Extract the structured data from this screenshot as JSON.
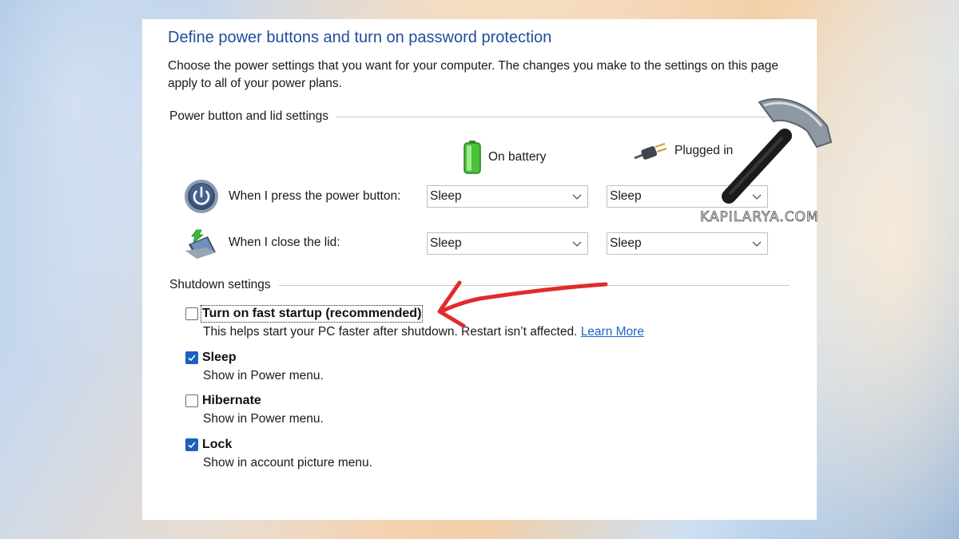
{
  "page_title": "Define power buttons and turn on password protection",
  "description": "Choose the power settings that you want for your computer. The changes you make to the settings on this page apply to all of your power plans.",
  "power_section": {
    "heading": "Power button and lid settings",
    "columns": {
      "battery": "On battery",
      "plugged": "Plugged in"
    },
    "rows": [
      {
        "label": "When I press the power button:",
        "battery_value": "Sleep",
        "plugged_value": "Sleep",
        "icon": "power-button-icon"
      },
      {
        "label": "When I close the lid:",
        "battery_value": "Sleep",
        "plugged_value": "Sleep",
        "icon": "laptop-lid-icon"
      }
    ]
  },
  "shutdown_section": {
    "heading": "Shutdown settings",
    "options": [
      {
        "label": "Turn on fast startup (recommended)",
        "checked": false,
        "description": "This helps start your PC faster after shutdown. Restart isn’t affected.",
        "link": "Learn More"
      },
      {
        "label": "Sleep",
        "checked": true,
        "description": "Show in Power menu."
      },
      {
        "label": "Hibernate",
        "checked": false,
        "description": "Show in Power menu."
      },
      {
        "label": "Lock",
        "checked": true,
        "description": "Show in account picture menu."
      }
    ]
  },
  "watermark": "KAPILARYA.COM",
  "colors": {
    "title": "#1e4e9a",
    "checkbox_checked": "#1f5fbf",
    "link": "#1a66c9",
    "arrow": "#e02b2b"
  }
}
